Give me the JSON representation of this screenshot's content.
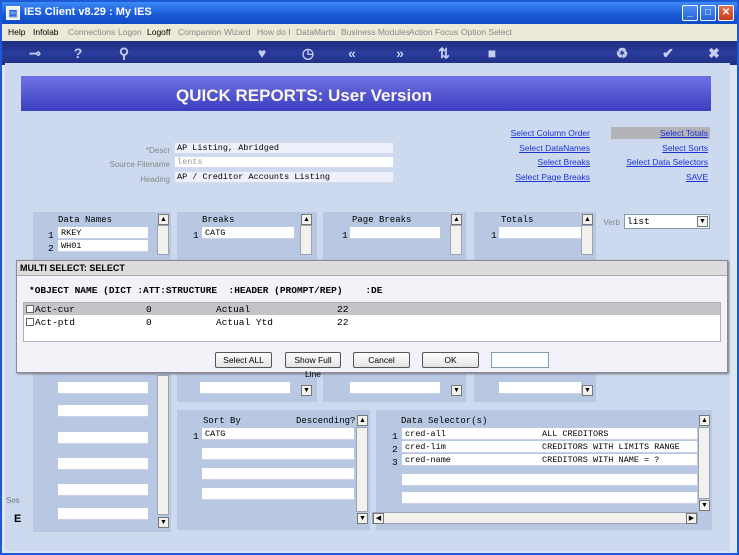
{
  "window": {
    "title": "IES Client v8.29 : My IES",
    "minimize": "_",
    "maximize": "□",
    "close": "✕"
  },
  "menu": [
    "Help",
    "Infolab",
    "Connections",
    "Logon",
    "Logoff",
    "Companion",
    "Wizard",
    "How do I",
    "DataMarts",
    "Business Modules",
    "Action Focus",
    "Option Select"
  ],
  "toolbar": {
    "icons": [
      "key-icon",
      "help-icon",
      "search-icon",
      "heart-icon",
      "clock-icon",
      "back-icon",
      "forward-icon",
      "sort-icon",
      "stop-icon",
      "recycle-icon",
      "ok-icon",
      "close-icon"
    ]
  },
  "page": {
    "title": "QUICK REPORTS: User Version"
  },
  "form": {
    "descr_label": "*Descr",
    "descr": "AP Listing, Abridged",
    "source_label": "Source Filename",
    "source": "lents",
    "heading_label": "Heading",
    "heading": "AP / Creditor Accounts Listing"
  },
  "links": {
    "col1": [
      "Select Column Order",
      "Select DataNames",
      "Select Breaks",
      "Select Page Breaks"
    ],
    "col2": [
      "Select Totals",
      "Select Sorts",
      "Select Data Selectors",
      "SAVE"
    ]
  },
  "verb": {
    "label": "Verb",
    "value": "list"
  },
  "data_names": {
    "header": "Data Names",
    "rows": [
      {
        "n": "1",
        "v": "RKEY"
      },
      {
        "n": "2",
        "v": "WH01"
      }
    ]
  },
  "breaks": {
    "header": "Breaks",
    "rows": [
      {
        "n": "1",
        "v": "CATG"
      }
    ]
  },
  "page_breaks": {
    "header": "Page Breaks",
    "rows": [
      {
        "n": "1",
        "v": ""
      }
    ]
  },
  "totals": {
    "header": "Totals",
    "rows": [
      {
        "n": "1",
        "v": ""
      }
    ]
  },
  "sort": {
    "header": "Sort By",
    "desc_header": "Descending?",
    "rows": [
      {
        "n": "1",
        "v": "CATG"
      }
    ]
  },
  "selectors": {
    "header": "Data Selector(s)",
    "rows": [
      {
        "n": "1",
        "v": "cred-all",
        "d": "ALL CREDITORS"
      },
      {
        "n": "2",
        "v": "cred-lim",
        "d": "CREDITORS WITH LIMITS RANGE"
      },
      {
        "n": "3",
        "v": "cred-name",
        "d": "CREDITORS WITH NAME = ?"
      }
    ]
  },
  "side": {
    "ses": "Ses",
    "e": "E"
  },
  "dialog": {
    "title": "MULTI SELECT: SELECT",
    "header": "*OBJECT NAME (DICT :ATT:STRUCTURE  :HEADER (PROMPT/REP)    :DE",
    "rows": [
      {
        "name": "Act-cur",
        "att": "0",
        "hdr": "Actual",
        "w": "22"
      },
      {
        "name": "Act-ptd",
        "att": "0",
        "hdr": "Actual Ytd",
        "w": "22"
      }
    ],
    "buttons": {
      "select_all": "Select ALL",
      "show_full": "Show Full Line",
      "cancel": "Cancel",
      "ok": "OK"
    },
    "search": ""
  }
}
